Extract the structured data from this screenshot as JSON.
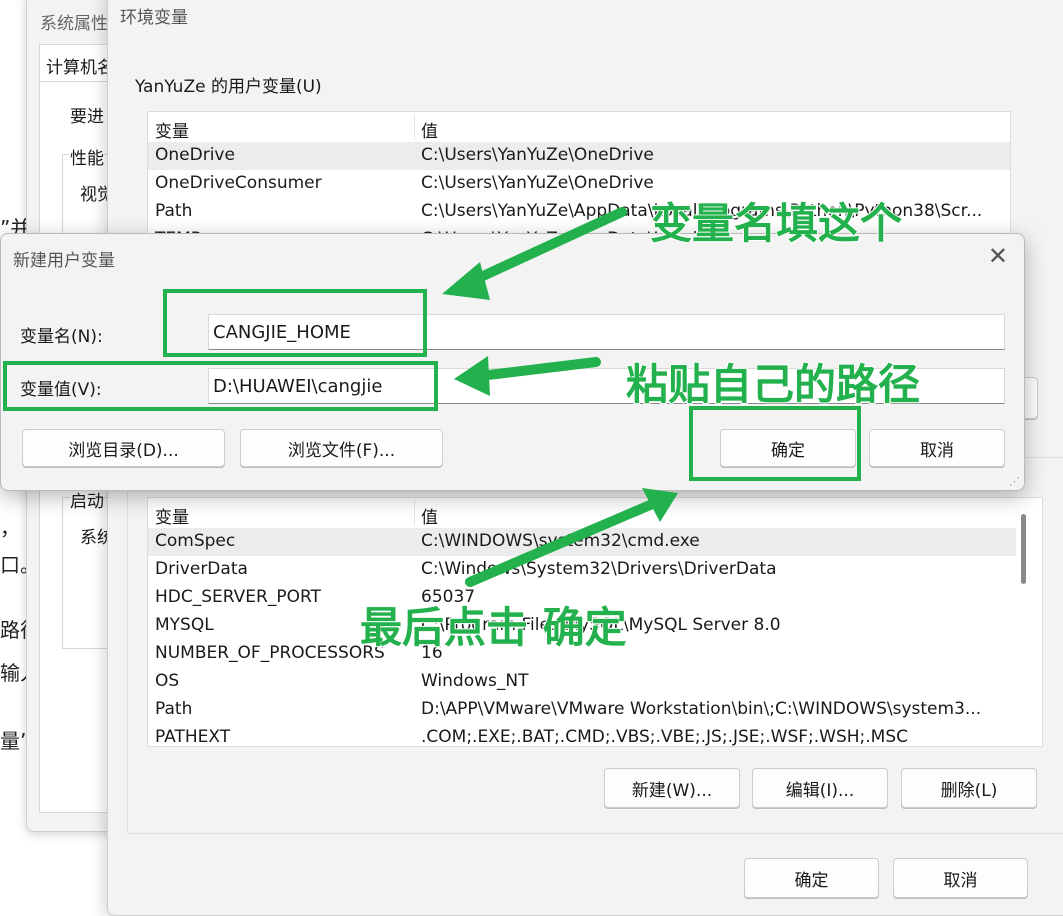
{
  "background_doc": {
    "fragments": [
      "”并",
      "，",
      "口。",
      "路径",
      "输入",
      "量”"
    ]
  },
  "system_properties": {
    "title": "系统属性",
    "tab": "计算机名",
    "fragments": [
      "要进",
      "性能",
      "视觉",
      "启动",
      "系统"
    ]
  },
  "env_window": {
    "title": "环境变量",
    "user_group_label": "YanYuZe 的用户变量(U)",
    "columns": [
      "变量",
      "值"
    ],
    "user_vars": [
      {
        "name": "OneDrive",
        "value": "C:\\Users\\YanYuZe\\OneDrive",
        "selected": true
      },
      {
        "name": "OneDriveConsumer",
        "value": "C:\\Users\\YanYuZe\\OneDrive",
        "selected": false
      },
      {
        "name": "Path",
        "value": "C:\\Users\\YanYuZe\\AppData\\Local\\Programs\\Python\\Python38\\Scr...",
        "selected": false
      },
      {
        "name": "TEMP",
        "value": "C:\\Users\\YanYuZe\\AppData\\Local\\Temp",
        "selected": false
      }
    ],
    "system_vars": [
      {
        "name": "ComSpec",
        "value": "C:\\WINDOWS\\system32\\cmd.exe",
        "selected": true
      },
      {
        "name": "DriverData",
        "value": "C:\\Windows\\System32\\Drivers\\DriverData",
        "selected": false
      },
      {
        "name": "HDC_SERVER_PORT",
        "value": "65037",
        "selected": false
      },
      {
        "name": "MYSQL",
        "value": "C:\\Program Files\\MySQL\\MySQL Server 8.0",
        "selected": false
      },
      {
        "name": "NUMBER_OF_PROCESSORS",
        "value": "16",
        "selected": false
      },
      {
        "name": "OS",
        "value": "Windows_NT",
        "selected": false
      },
      {
        "name": "Path",
        "value": "D:\\APP\\VMware\\VMware Workstation\\bin\\;C:\\WINDOWS\\system3...",
        "selected": false
      },
      {
        "name": "PATHEXT",
        "value": ".COM;.EXE;.BAT;.CMD;.VBS;.VBE;.JS;.JSE;.WSF;.WSH;.MSC",
        "selected": false
      }
    ],
    "system_buttons": {
      "new": "新建(W)...",
      "edit": "编辑(I)...",
      "delete": "删除(L)"
    },
    "footer_buttons": {
      "ok": "确定",
      "cancel": "取消"
    }
  },
  "new_var_dialog": {
    "title": "新建用户变量",
    "close_glyph": "✕",
    "name_label": "变量名(N):",
    "name_value": "CANGJIE_HOME",
    "value_label": "变量值(V):",
    "value_value": "D:\\HUAWEI\\cangjie",
    "browse_dir": "浏览目录(D)...",
    "browse_file": "浏览文件(F)...",
    "ok": "确定",
    "cancel": "取消"
  },
  "annotations": {
    "name_hint": "变量名填这个",
    "path_hint": "粘贴自己的路径",
    "confirm_hint": "最后点击 确定",
    "color": "#22b14c"
  }
}
